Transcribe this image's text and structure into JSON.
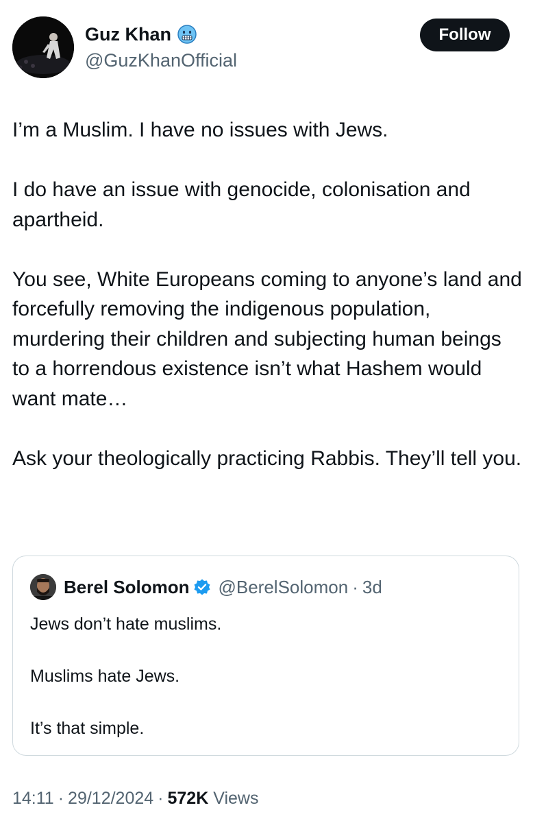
{
  "author": {
    "name": "Guz Khan",
    "handle": "@GuzKhanOfficial",
    "badge_icon": "cold-face-emoji-icon"
  },
  "follow_button": {
    "label": "Follow"
  },
  "tweet": {
    "paragraphs": [
      "I’m a Muslim. I have no issues with Jews.",
      "I do have an issue with genocide, colonisation and apartheid.",
      "You see, White Europeans coming to anyone’s land and forcefully removing the indigenous population, murdering their children and subjecting human beings to a horrendous existence isn’t what Hashem would want mate…",
      "Ask your theologically practicing Rabbis. They’ll tell you."
    ]
  },
  "quote": {
    "name": "Berel Solomon",
    "verified_icon": "verified-badge-icon",
    "handle": "@BerelSolomon",
    "separator": "·",
    "time": "3d",
    "paragraphs": [
      "Jews don’t hate muslims.",
      "Muslims hate Jews.",
      "It’s that simple."
    ]
  },
  "meta": {
    "time": "14:11",
    "separator": "·",
    "date": "29/12/2024",
    "views_count": "572K",
    "views_label": "Views"
  },
  "colors": {
    "text_primary": "#0f1419",
    "text_secondary": "#536471",
    "verified_blue": "#1d9bf0",
    "border": "#cfd9de",
    "follow_bg": "#0f1419"
  }
}
